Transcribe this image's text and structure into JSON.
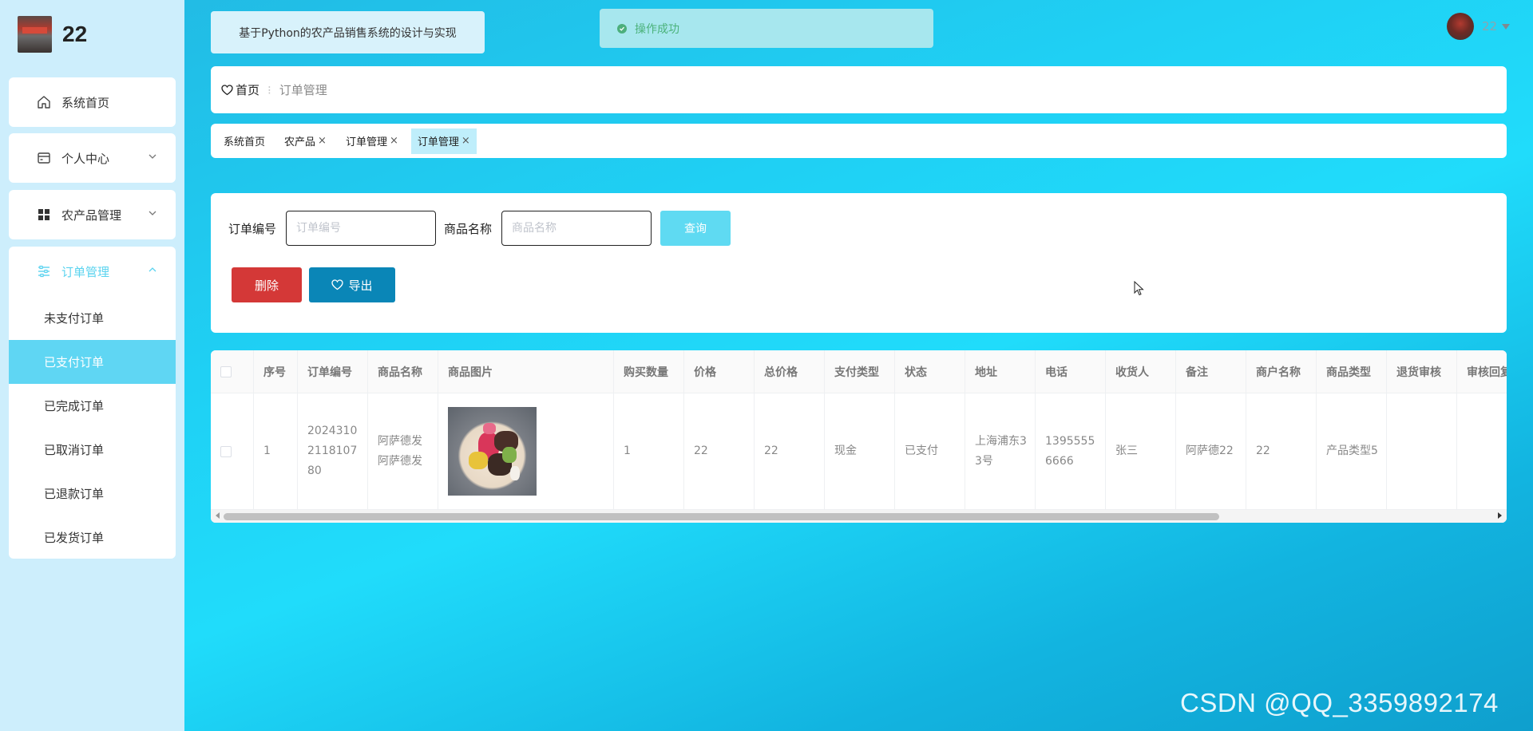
{
  "brand": {
    "name": "22",
    "logo_icon": "shop-photo"
  },
  "app_title": "基于Python的农产品销售系统的设计与实现",
  "toast": {
    "text": "操作成功",
    "icon": "check-circle-icon",
    "color": "#4caf7c"
  },
  "user": {
    "name": "22"
  },
  "sidebar": {
    "items": [
      {
        "label": "系统首页",
        "icon": "home-icon"
      },
      {
        "label": "个人中心",
        "icon": "wallet-icon"
      },
      {
        "label": "农产品管理",
        "icon": "grid-icon"
      },
      {
        "label": "订单管理",
        "icon": "sliders-icon",
        "expanded": true
      }
    ],
    "order_submenu": [
      "未支付订单",
      "已支付订单",
      "已完成订单",
      "已取消订单",
      "已退款订单",
      "已发货订单"
    ],
    "selected_submenu": "已支付订单"
  },
  "breadcrumb": {
    "home": "首页",
    "separator": "⁝",
    "current": "订单管理"
  },
  "tabs": [
    {
      "label": "系统首页",
      "closable": false
    },
    {
      "label": "农产品",
      "closable": true
    },
    {
      "label": "订单管理",
      "closable": true
    },
    {
      "label": "订单管理",
      "closable": true,
      "active": true
    }
  ],
  "search": {
    "order_no_label": "订单编号",
    "order_no_placeholder": "订单编号",
    "product_name_label": "商品名称",
    "product_name_placeholder": "商品名称",
    "query_button": "查询",
    "delete_button": "删除",
    "export_button": "导出"
  },
  "table": {
    "columns": [
      "序号",
      "订单编号",
      "商品名称",
      "商品图片",
      "购买数量",
      "价格",
      "总价格",
      "支付类型",
      "状态",
      "地址",
      "电话",
      "收货人",
      "备注",
      "商户名称",
      "商品类型",
      "退货审核",
      "审核回复"
    ],
    "rows": [
      {
        "index": "1",
        "order_no": "20243102118107 80",
        "product_name": "阿萨德发阿萨德发",
        "quantity": "1",
        "price": "22",
        "total": "22",
        "pay_type": "现金",
        "status": "已支付",
        "address": "上海浦东33号",
        "phone": "13955556666",
        "receiver": "张三",
        "remark": "阿萨德22",
        "merchant": "22",
        "product_type": "产品类型5",
        "return_review": "",
        "review_reply": ""
      }
    ]
  },
  "watermark": "CSDN @QQ_3359892174",
  "colors": {
    "accent": "#5fd6f3",
    "delete": "#d43837",
    "export": "#0a86b7",
    "query": "#5fdaf2"
  }
}
